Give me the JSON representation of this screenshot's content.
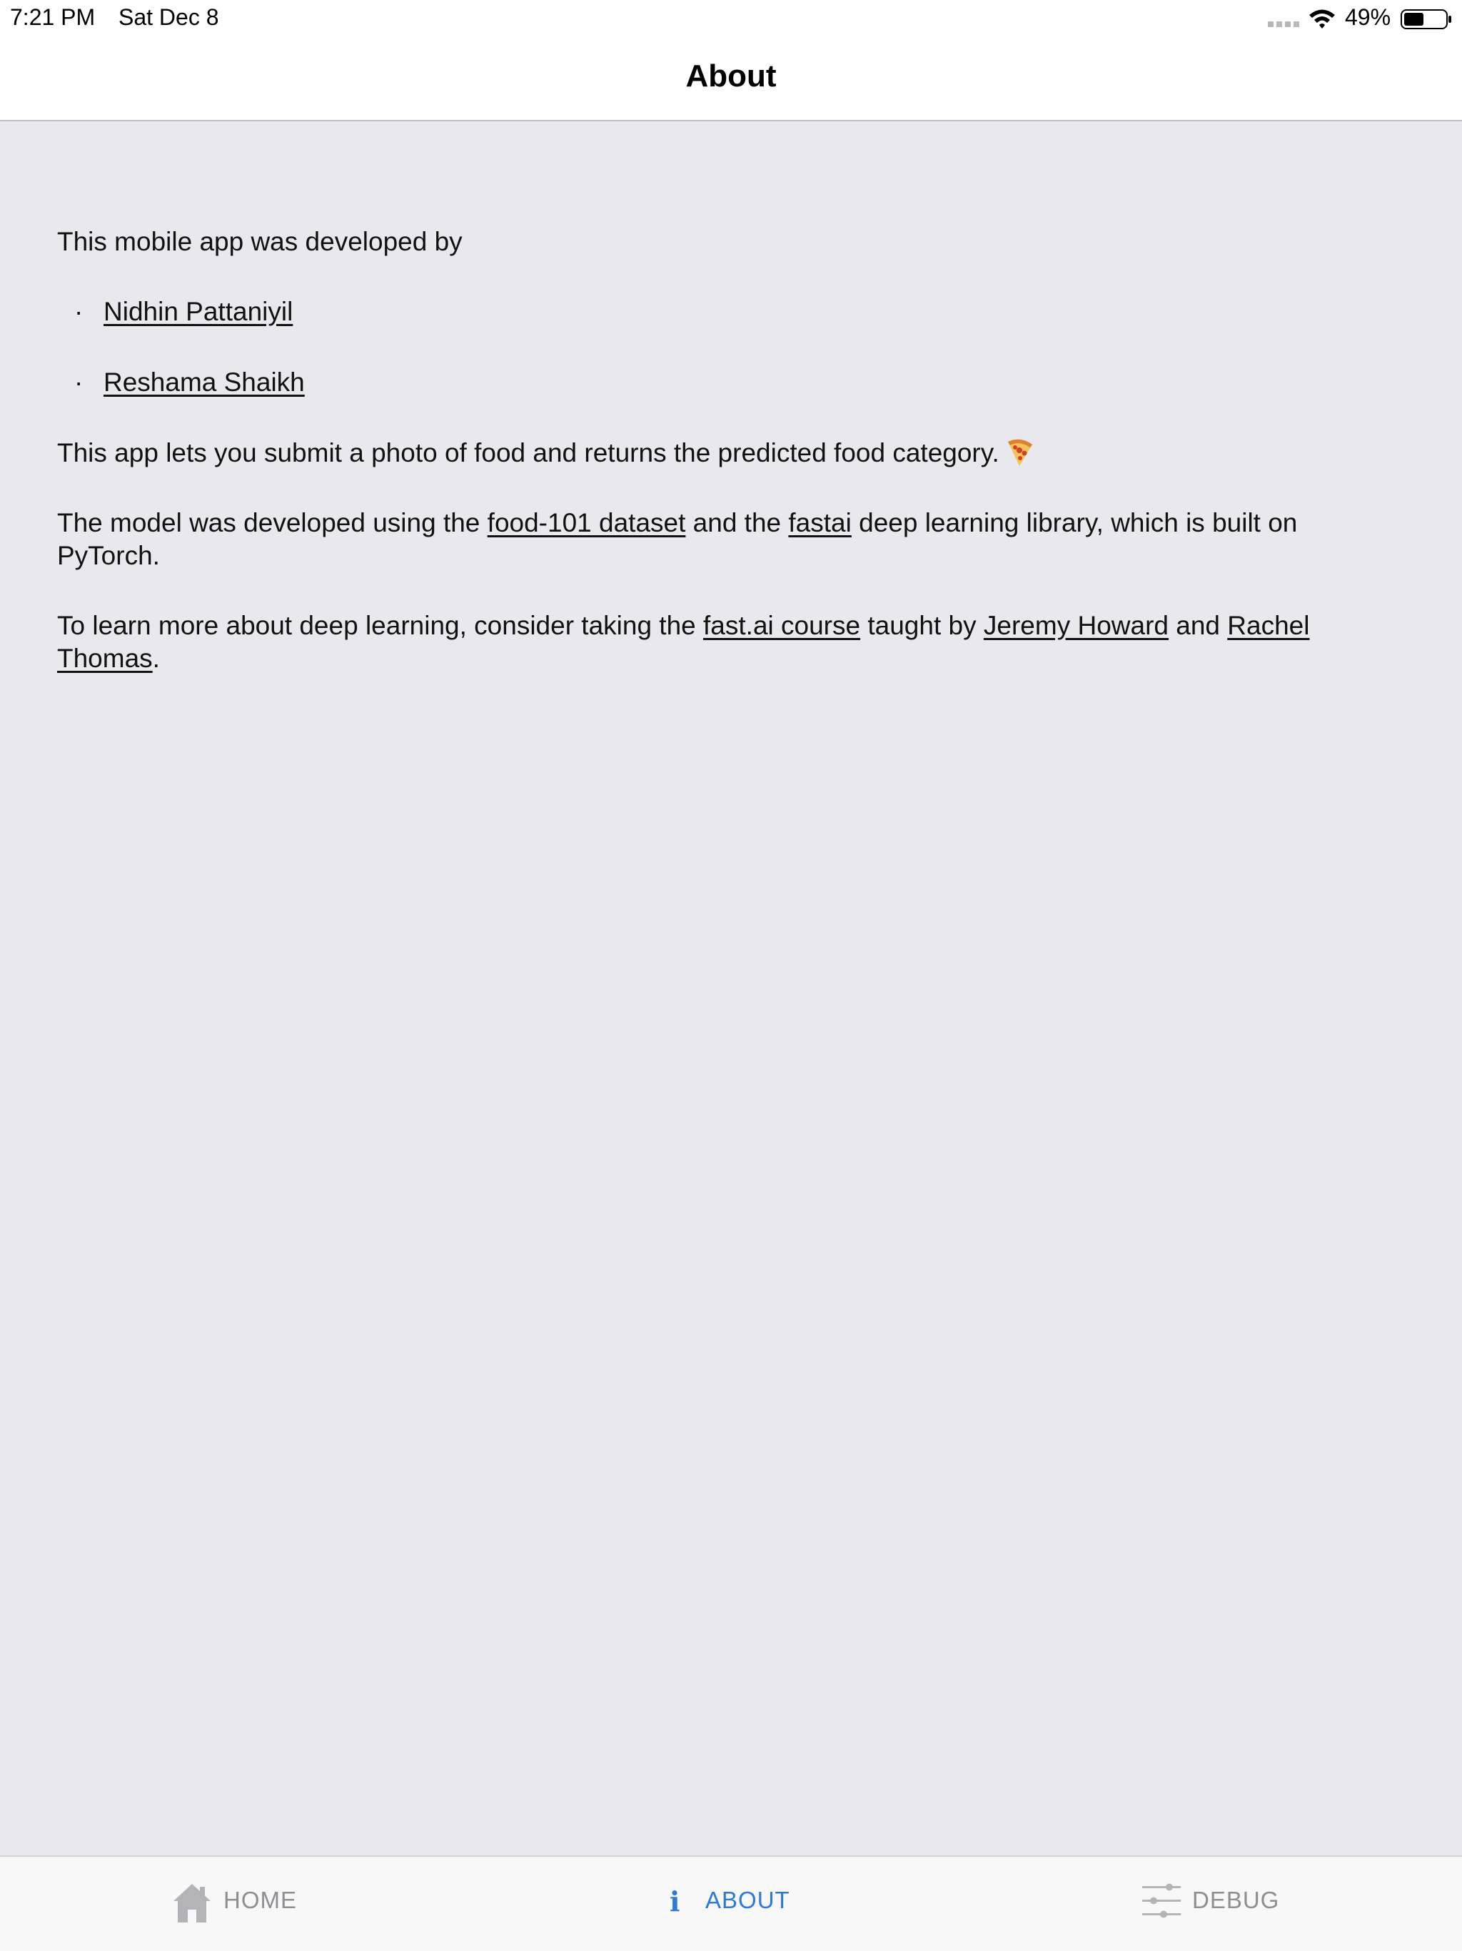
{
  "status_bar": {
    "time": "7:21 PM",
    "date": "Sat Dec 8",
    "battery_percent": "49%",
    "battery_level": 0.49
  },
  "nav": {
    "title": "About"
  },
  "content": {
    "intro": "This mobile app was developed by",
    "authors": [
      {
        "name": "Nidhin Pattaniyil"
      },
      {
        "name": "Reshama Shaikh"
      }
    ],
    "bullet": "·",
    "description": "This app lets you submit a photo of food and returns the predicted food category.",
    "model_paragraph": {
      "part1": "The model was developed using the ",
      "link1": "food-101 dataset",
      "part2": " and the ",
      "link2": "fastai",
      "part3": " deep learning library, which is built on PyTorch."
    },
    "learn_paragraph": {
      "part1": "To learn more about deep learning, consider taking the ",
      "link1": "fast.ai course",
      "part2": " taught by ",
      "link2": "Jeremy Howard",
      "part3": " and ",
      "link3": "Rachel Thomas",
      "part4": "."
    }
  },
  "tab_bar": {
    "tabs": [
      {
        "label": "HOME",
        "icon": "home-icon",
        "active": false
      },
      {
        "label": "ABOUT",
        "icon": "info-icon",
        "active": true
      },
      {
        "label": "DEBUG",
        "icon": "sliders-icon",
        "active": false
      }
    ],
    "info_glyph": "i"
  },
  "colors": {
    "background": "#e8e8ee",
    "bar_background": "#ffffff",
    "tab_active": "#2f7ad8",
    "tab_inactive": "#8e8e93",
    "text": "#111111"
  }
}
